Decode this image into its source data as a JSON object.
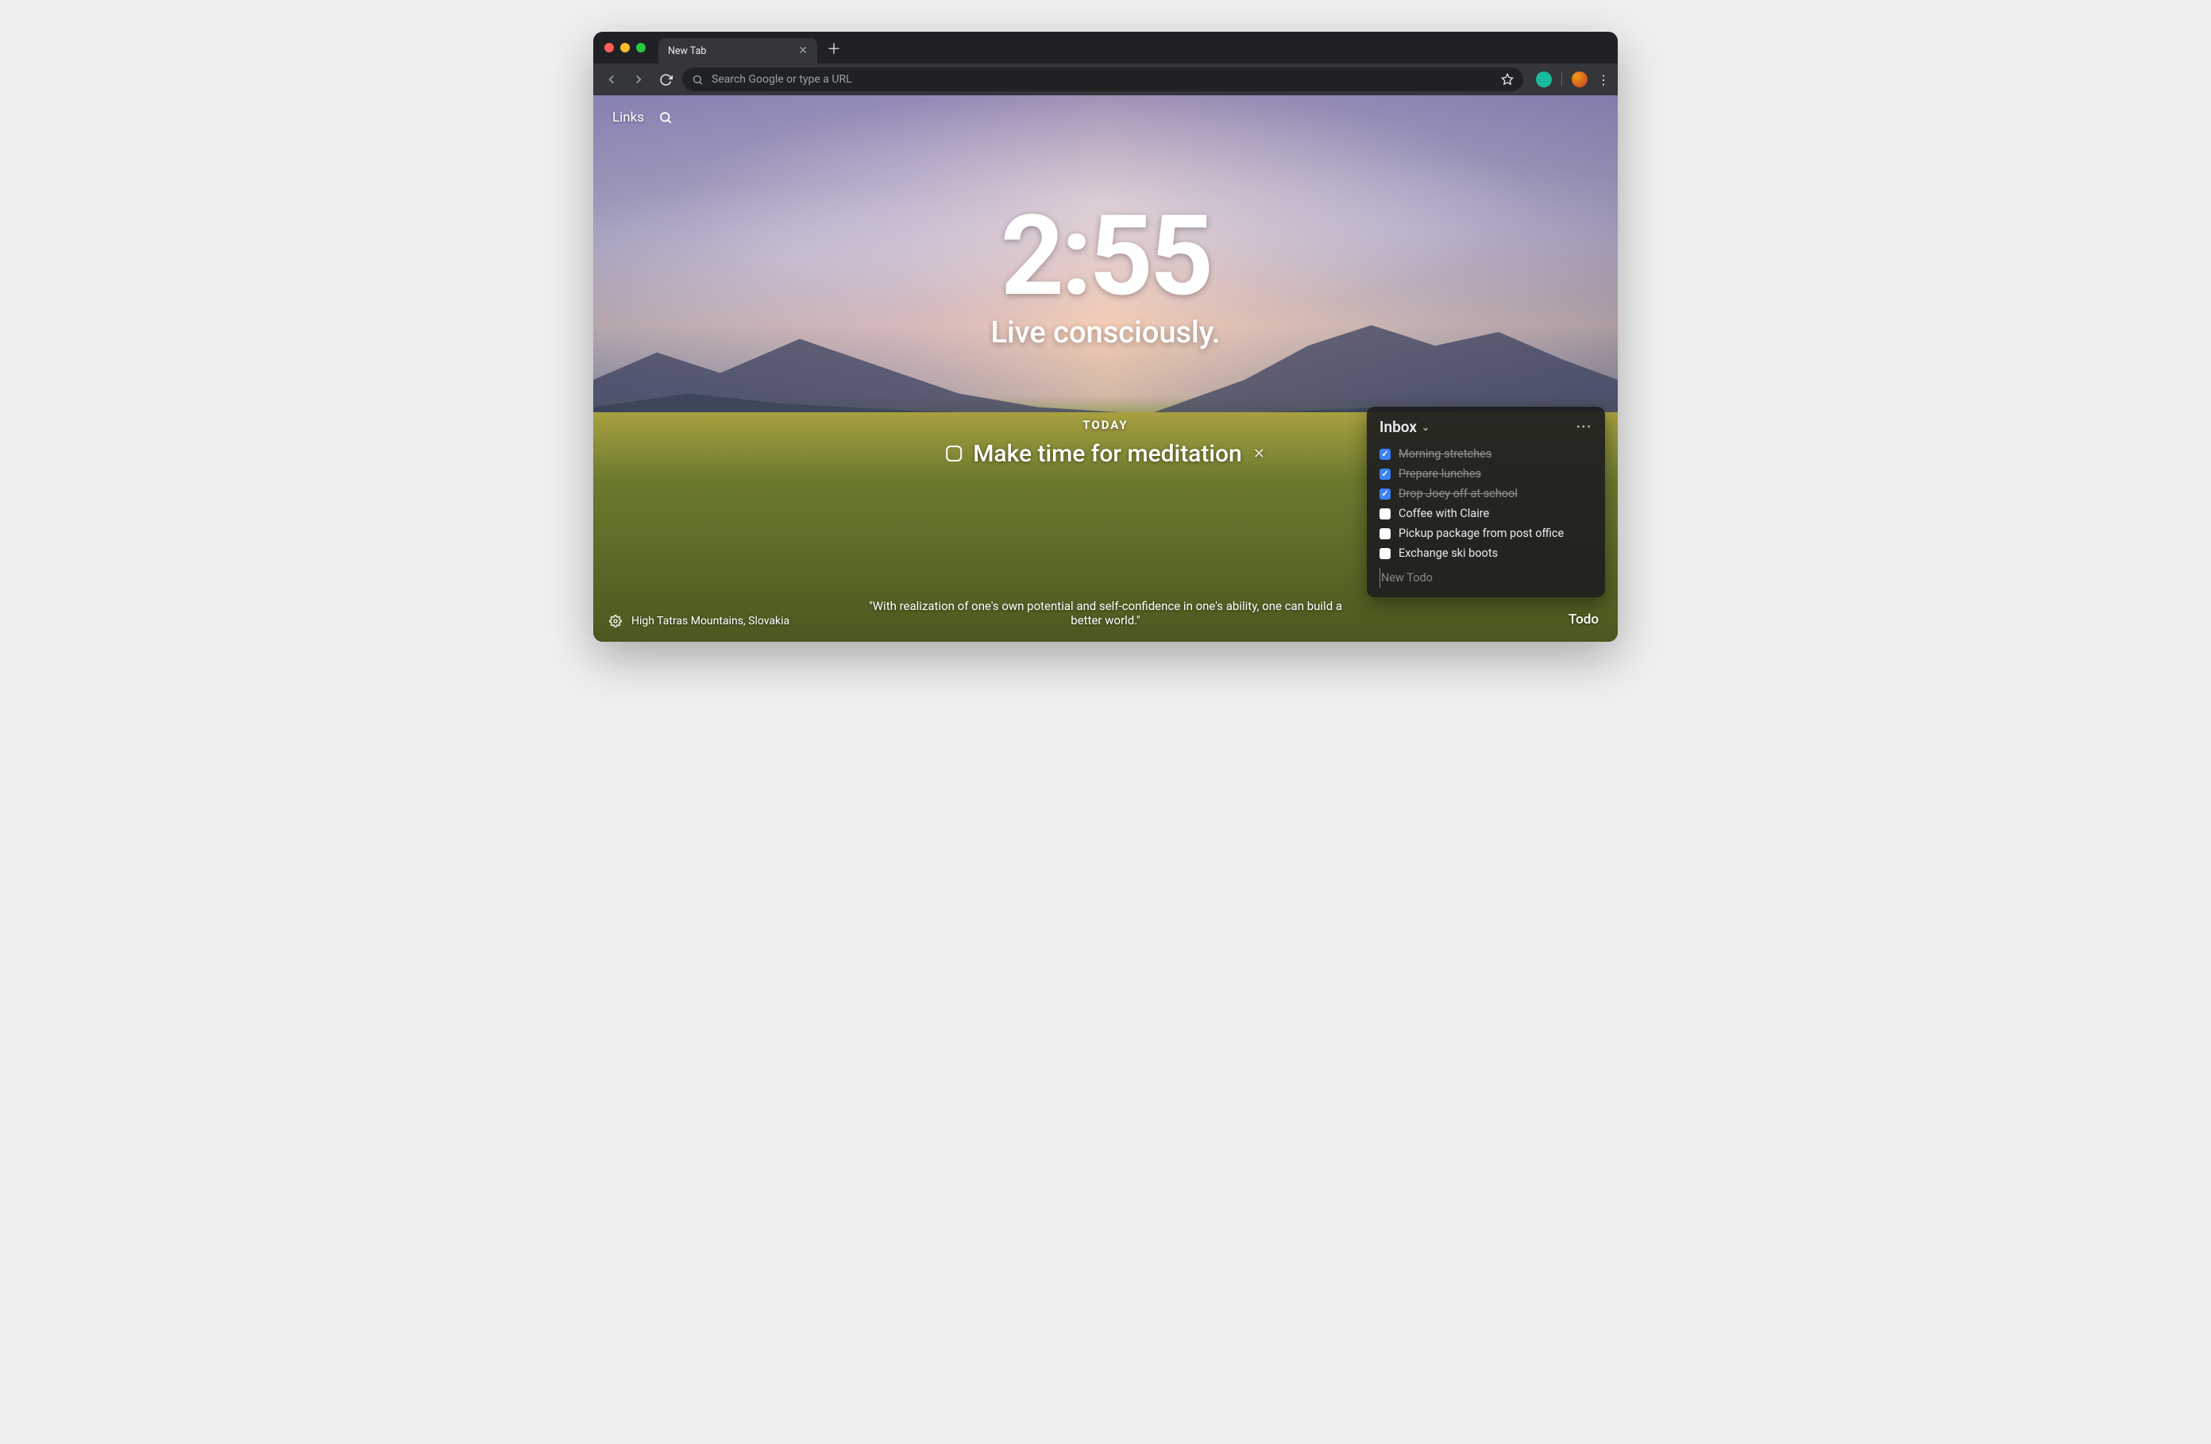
{
  "browser": {
    "tab_title": "New Tab",
    "omnibox_placeholder": "Search Google or type a URL"
  },
  "top_left": {
    "links_label": "Links"
  },
  "clock": {
    "time": "2:55",
    "mantra": "Live consciously."
  },
  "focus": {
    "label": "TODAY",
    "text": "Make time for meditation"
  },
  "todo": {
    "title": "Inbox",
    "items": [
      {
        "label": "Morning stretches",
        "done": true
      },
      {
        "label": "Prepare lunches",
        "done": true
      },
      {
        "label": "Drop Joey off at school",
        "done": true
      },
      {
        "label": "Coffee with Claire",
        "done": false
      },
      {
        "label": "Pickup package from post office",
        "done": false
      },
      {
        "label": "Exchange ski boots",
        "done": false
      }
    ],
    "new_placeholder": "New Todo"
  },
  "quote": {
    "text": "\"With realization of one's own potential and self-confidence in one's ability, one can build a better world.\""
  },
  "location": {
    "text": "High Tatras Mountains, Slovakia"
  },
  "bottom_right": {
    "todo_label": "Todo"
  }
}
